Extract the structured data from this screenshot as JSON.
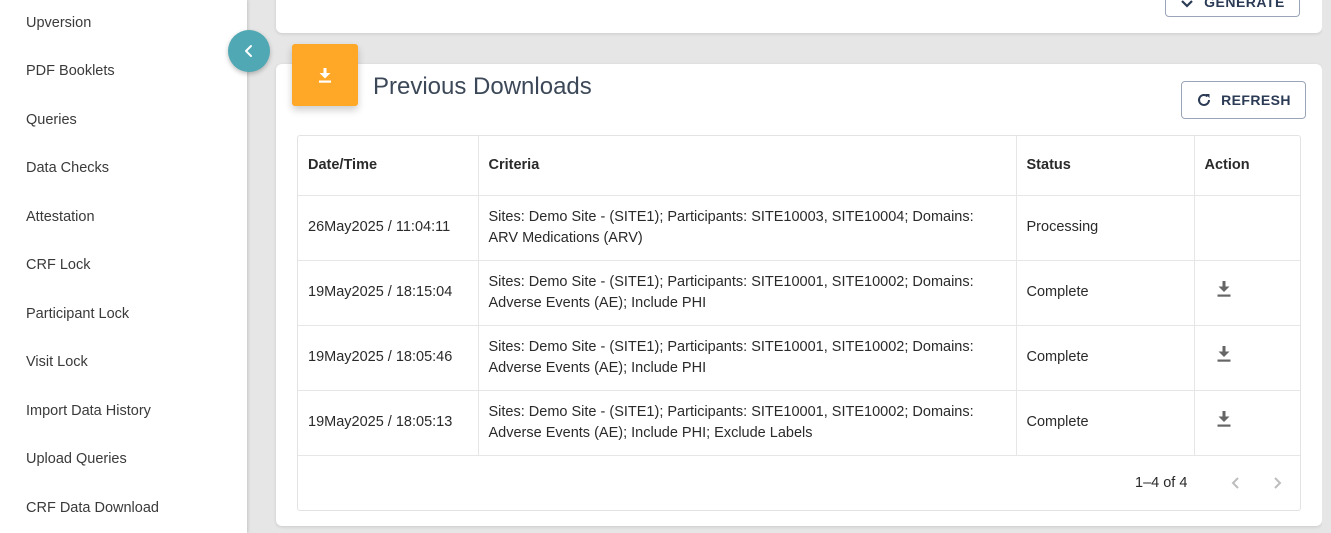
{
  "sidebar": {
    "items": [
      {
        "label": "Upversion"
      },
      {
        "label": "PDF Booklets"
      },
      {
        "label": "Queries"
      },
      {
        "label": "Data Checks"
      },
      {
        "label": "Attestation"
      },
      {
        "label": "CRF Lock"
      },
      {
        "label": "Participant Lock"
      },
      {
        "label": "Visit Lock"
      },
      {
        "label": "Import Data History"
      },
      {
        "label": "Upload Queries"
      },
      {
        "label": "CRF Data Download"
      }
    ]
  },
  "top_card": {
    "generate_label": "GENERATE"
  },
  "downloads": {
    "title": "Previous Downloads",
    "refresh_label": "REFRESH",
    "columns": [
      "Date/Time",
      "Criteria",
      "Status",
      "Action"
    ],
    "rows": [
      {
        "datetime": "26May2025 / 11:04:11",
        "criteria": "Sites: Demo Site - (SITE1); Participants: SITE10003, SITE10004; Domains: ARV Medications (ARV)",
        "status": "Processing",
        "action": ""
      },
      {
        "datetime": "19May2025 / 18:15:04",
        "criteria": "Sites: Demo Site - (SITE1); Participants: SITE10001, SITE10002; Domains: Adverse Events (AE); Include PHI",
        "status": "Complete",
        "action": "download-icon"
      },
      {
        "datetime": "19May2025 / 18:05:46",
        "criteria": "Sites: Demo Site - (SITE1); Participants: SITE10001, SITE10002; Domains: Adverse Events (AE); Include PHI",
        "status": "Complete",
        "action": "download-icon"
      },
      {
        "datetime": "19May2025 / 18:05:13",
        "criteria": "Sites: Demo Site - (SITE1); Participants: SITE10001, SITE10002; Domains: Adverse Events (AE); Include PHI; Exclude Labels",
        "status": "Complete",
        "action": "download-icon"
      }
    ],
    "pagination": {
      "range": "1–4 of 4"
    }
  },
  "colors": {
    "accent": "#ffa726",
    "teal": "#4fa8b3",
    "button_text": "#2b3a55"
  }
}
